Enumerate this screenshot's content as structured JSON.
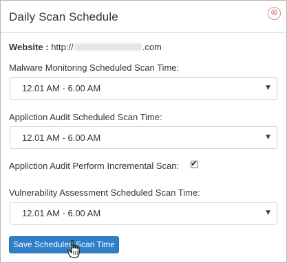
{
  "dialog": {
    "title": "Daily Scan Schedule",
    "close_glyph": "⊗"
  },
  "website": {
    "label": "Website :",
    "url_prefix": "http://",
    "url_suffix": ".com"
  },
  "fields": [
    {
      "label": "Malware Monitoring Scheduled Scan Time:",
      "value": "12.01 AM - 6.00 AM"
    },
    {
      "label": "Appliction Audit Scheduled Scan Time:",
      "value": "12.01 AM - 6.00 AM"
    },
    {
      "label": "Vulnerability Assessment Scheduled Scan Time:",
      "value": "12.01 AM - 6.00 AM"
    }
  ],
  "incremental": {
    "label": "Appliction Audit Perform Incremental Scan:",
    "checked": true
  },
  "icons": {
    "close": "close-circle-icon",
    "caret": "caret-down-icon",
    "check": "checkmark-icon",
    "cursor": "hand-pointer-cursor"
  },
  "buttons": {
    "save_label": "Save Scheduled Scan Time"
  },
  "colors": {
    "primary": "#2f7fc8",
    "close": "#e07b7b"
  }
}
